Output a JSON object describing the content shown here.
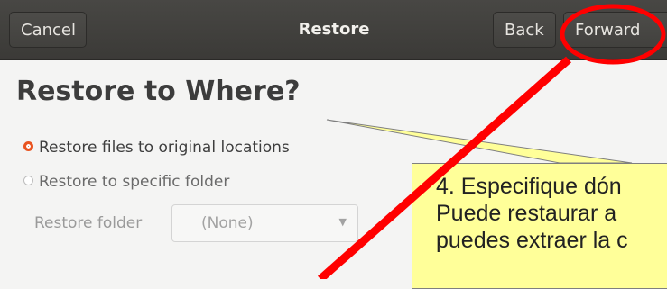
{
  "header": {
    "cancel_label": "Cancel",
    "title": "Restore",
    "back_label": "Back",
    "forward_label": "Forward"
  },
  "main": {
    "heading": "Restore to Where?",
    "options": [
      {
        "label": "Restore files to original locations",
        "selected": true
      },
      {
        "label": "Restore to specific folder",
        "selected": false
      }
    ],
    "restore_folder_label": "Restore folder",
    "restore_folder_value": "(None)"
  },
  "annotation": {
    "lines": [
      "4. Especifique dón",
      "Puede restaurar a",
      "puedes extraer la c"
    ]
  },
  "colors": {
    "header_bg": "#3f3e3b",
    "accent_radio": "#e95420",
    "callout_bg": "#ffff99",
    "highlight_red": "#ff0000"
  }
}
